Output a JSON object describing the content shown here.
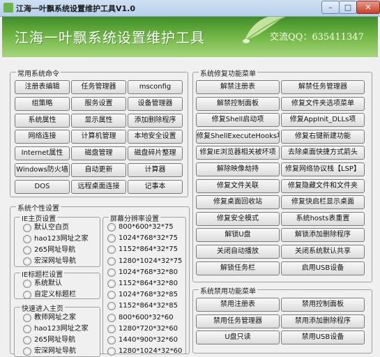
{
  "window": {
    "title": "江海一叶飘系统设置维护工具V1.0",
    "controls": {
      "minimize": "–",
      "maximize": "□",
      "close": "✕"
    }
  },
  "banner": {
    "title_left": "江海一叶飘系统设置维护工具",
    "title_right": "交流QQ：635411347",
    "colors": {
      "dark": "#3f8d2a",
      "light": "#a8d67a"
    },
    "icon": "leaf-icon"
  },
  "common": {
    "legend": "常用系统命令",
    "buttons": [
      [
        "注册表编辑",
        "任务管理器",
        "msconfig"
      ],
      [
        "组策略",
        "服务设置",
        "设备管理器"
      ],
      [
        "系统属性",
        "显示属性",
        "添加删除程序"
      ],
      [
        "网络连接",
        "计算机管理",
        "本地安全设置"
      ],
      [
        "Internet属性",
        "磁盘管理",
        "磁盘碎片整理"
      ],
      [
        "Windows防火墙",
        "自动更新",
        "计算器"
      ],
      [
        "DOS",
        "远程桌面连接",
        "记事本"
      ]
    ]
  },
  "repair": {
    "legend": "系统修复功能菜单",
    "buttons": [
      [
        "解禁注册表",
        "解禁任务管理器"
      ],
      [
        "解禁控制面板",
        "修复文件夹选项菜单"
      ],
      [
        "修复Shell启动项",
        "修复AppInit_DLLs项"
      ],
      [
        "修复ShellExecuteHooks项",
        "修复右键新建功能"
      ],
      [
        "修复IE浏览器相关被坏项",
        "去除桌面快捷方式箭头"
      ],
      [
        "解除映像劫持",
        "修复网络协议栈【LSP】"
      ],
      [
        "修复文件关联",
        "修复隐藏文件和文件夹"
      ],
      [
        "修复桌面回收站",
        "修复快启栏显示桌面"
      ],
      [
        "修复安全模式",
        "系统hosts表重置"
      ],
      [
        "解锁U盘",
        "解锁添加删除程序"
      ],
      [
        "关闭自动播放",
        "关闭系统默认共享"
      ],
      [
        "解锁任务栏",
        "启用USB设备"
      ]
    ]
  },
  "personal": {
    "legend": "系统个性设置",
    "ie_home": {
      "legend": "IE主页设置",
      "options": [
        "默认空白页",
        "hao123网址之家",
        "265网址导航",
        "宏深网址导航"
      ]
    },
    "ie_title": {
      "legend": "IE标题栏设置",
      "options": [
        "系统默认",
        "自定义标题栏"
      ]
    },
    "quick_home": {
      "legend": "快速进入主页",
      "options": [
        "教师网址之家",
        "hao123网址之家",
        "265网址导航",
        "宏深网址导航"
      ]
    },
    "resolution": {
      "legend": "屏幕分辨率设置",
      "options": [
        "800*600*32*75",
        "1024*768*32*75",
        "1152*864*32*75",
        "1280*1024*32*75",
        "1024*768*32*80",
        "1152*864*32*80",
        "1024*768*32*85",
        "1152*864*32*85",
        "800*600*32*60",
        "1280*720*32*60",
        "1440*900*32*60",
        "1280*1024*32*60"
      ]
    }
  },
  "disable": {
    "legend": "系统禁用功能菜单",
    "buttons": [
      [
        "禁用注册表",
        "禁用控制面板"
      ],
      [
        "禁用任务管理器",
        "禁用添加删除程序"
      ],
      [
        "U盘只读",
        "禁用USB设备"
      ]
    ]
  }
}
